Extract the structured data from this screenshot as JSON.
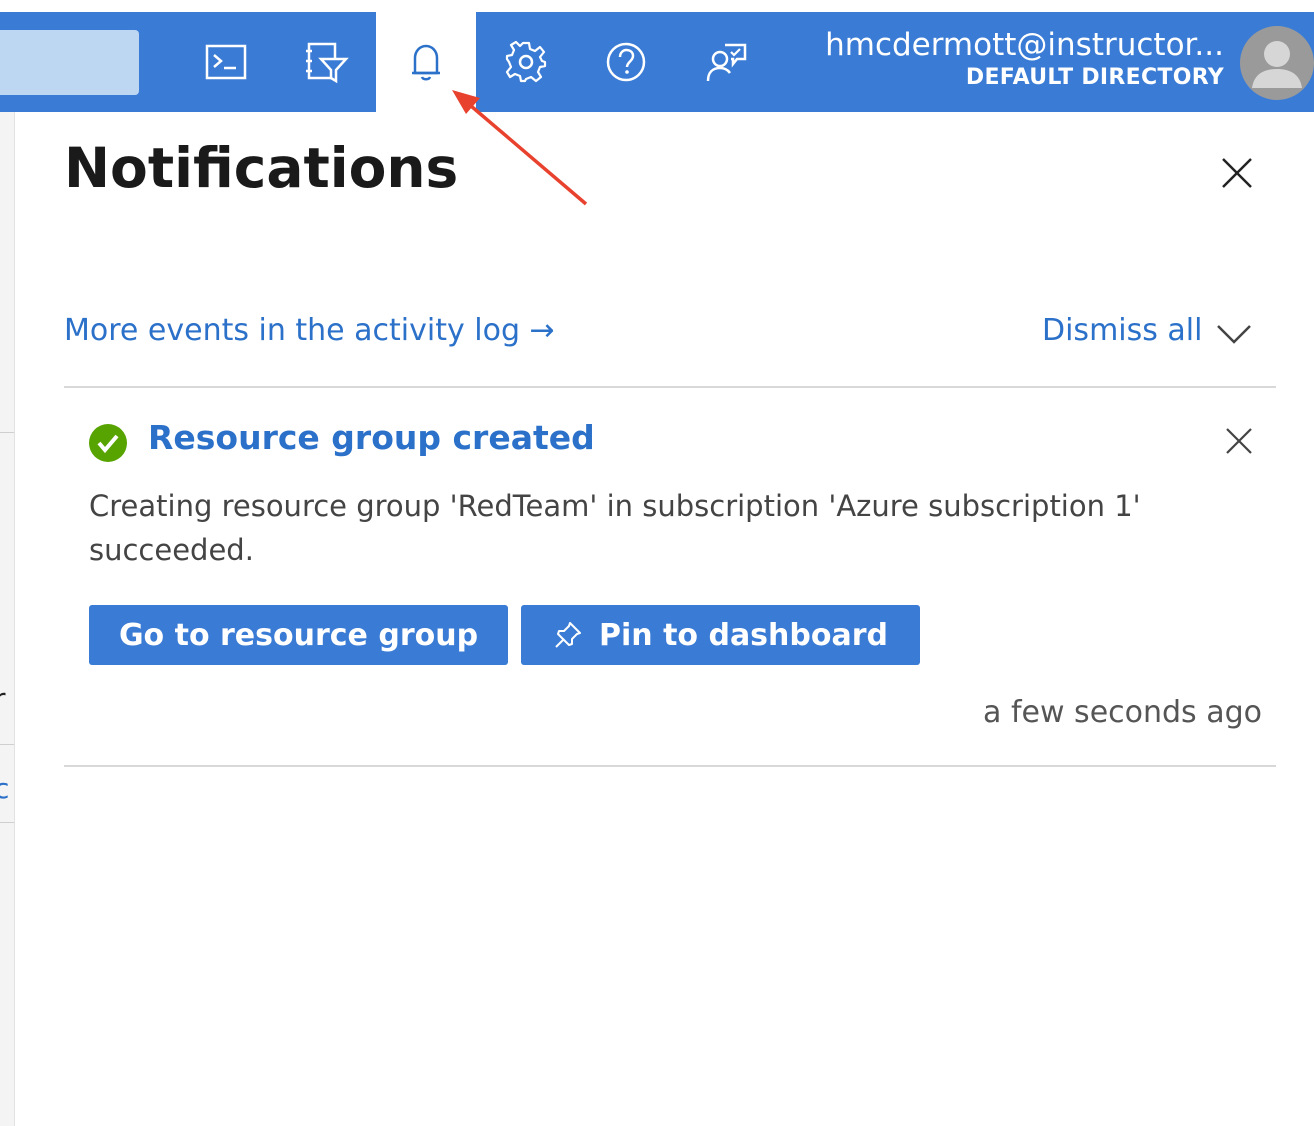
{
  "topbar": {
    "account_name": "hmcdermott@instructor...",
    "account_directory": "DEFAULT DIRECTORY",
    "icons": [
      "cloud-shell-icon",
      "directory-filter-icon",
      "notifications-bell-icon",
      "settings-gear-icon",
      "help-question-icon",
      "feedback-icon"
    ],
    "active_icon": "notifications-bell-icon"
  },
  "background_page": {
    "fragment_1": "r",
    "fragment_2": "c"
  },
  "panel": {
    "title": "Notifications",
    "activity_link": "More events in the activity log →",
    "dismiss_all": "Dismiss all"
  },
  "notification": {
    "title": "Resource group created",
    "body": "Creating resource group 'RedTeam' in subscription 'Azure subscription 1' succeeded.",
    "primary_action": "Go to resource group",
    "secondary_action": "Pin to dashboard",
    "timestamp": "a few seconds ago",
    "status": "success"
  },
  "colors": {
    "brand_blue": "#3a7bd5",
    "link_blue": "#2b70c9",
    "success_green": "#57a300",
    "annotation_red": "#e8422f"
  }
}
